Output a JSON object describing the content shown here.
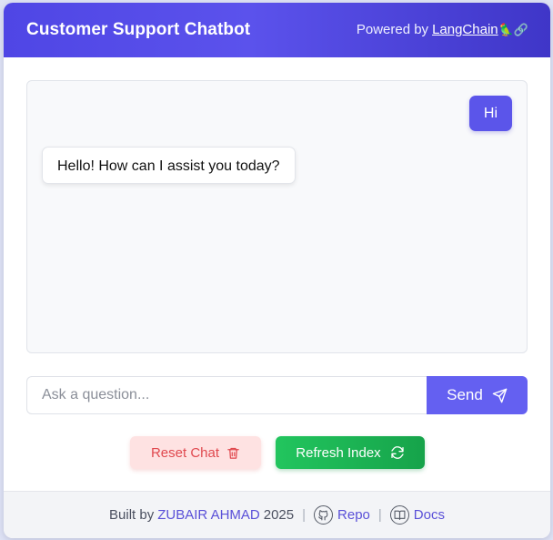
{
  "header": {
    "title": "Customer Support Chatbot",
    "powered_by": "Powered by",
    "powered_link": "LangChain",
    "powered_emoji": "🦜🔗"
  },
  "chat": {
    "messages": [
      {
        "role": "user",
        "text": "Hi"
      },
      {
        "role": "bot",
        "text": "Hello! How can I assist you today?"
      }
    ]
  },
  "input": {
    "placeholder": "Ask a question...",
    "value": "",
    "send_label": "Send",
    "send_icon": "send-icon"
  },
  "actions": {
    "reset_label": "Reset Chat",
    "reset_icon": "trash-icon",
    "refresh_label": "Refresh Index",
    "refresh_icon": "refresh-icon"
  },
  "footer": {
    "built_by": "Built by",
    "author": "ZUBAIR AHMAD",
    "year": "2025",
    "repo_label": "Repo",
    "repo_icon": "github-icon",
    "docs_label": "Docs",
    "docs_icon": "book-icon"
  },
  "colors": {
    "primary": "#4f46e5",
    "send": "#6460f1",
    "reset_bg": "#fee2e2",
    "reset_text": "#e0484e",
    "refresh": "#22c55e"
  }
}
